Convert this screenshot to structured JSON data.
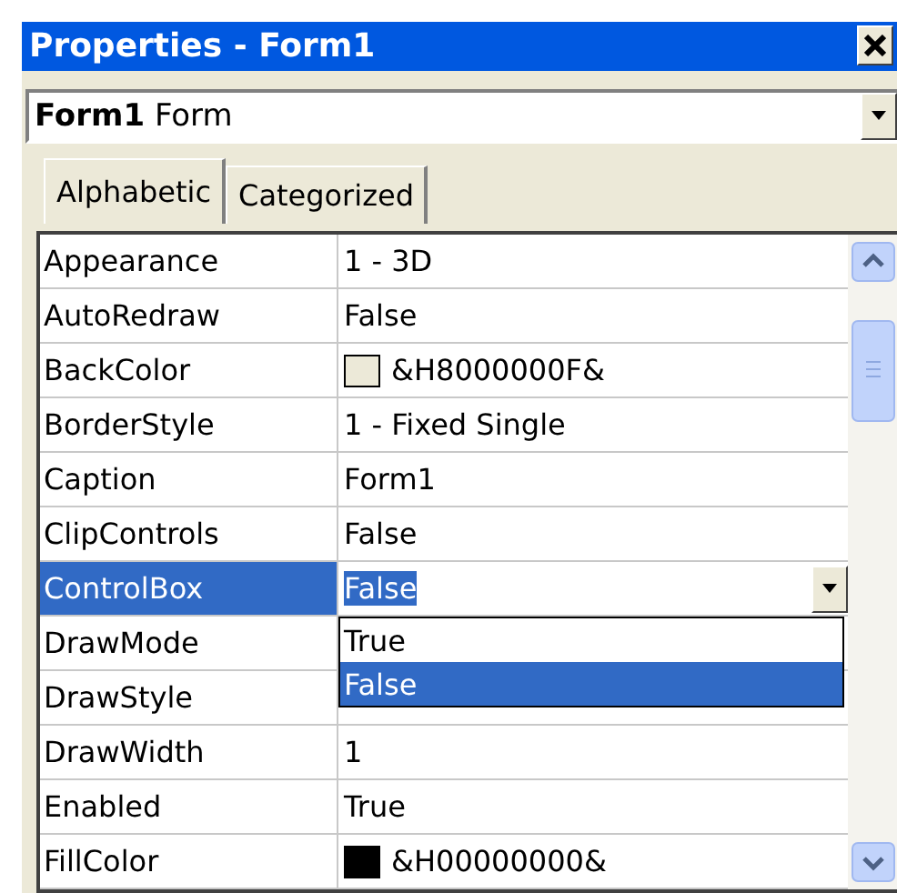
{
  "window": {
    "title": "Properties - Form1"
  },
  "object_selector": {
    "name": "Form1",
    "type": "Form"
  },
  "tabs": [
    {
      "label": "Alphabetic",
      "selected": true
    },
    {
      "label": "Categorized",
      "selected": false
    }
  ],
  "properties": [
    {
      "name": "Appearance",
      "value": "1 - 3D",
      "selected": false
    },
    {
      "name": "AutoRedraw",
      "value": "False",
      "selected": false
    },
    {
      "name": "BackColor",
      "value": "&H8000000F&",
      "color": "#ece9d8",
      "selected": false
    },
    {
      "name": "BorderStyle",
      "value": "1 - Fixed Single",
      "selected": false
    },
    {
      "name": "Caption",
      "value": "Form1",
      "selected": false
    },
    {
      "name": "ClipControls",
      "value": "False",
      "selected": false
    },
    {
      "name": "ControlBox",
      "value": "False",
      "selected": true,
      "dropdown": {
        "options": [
          {
            "label": "True",
            "selected": false
          },
          {
            "label": "False",
            "selected": true
          }
        ]
      }
    },
    {
      "name": "DrawMode",
      "selected": false
    },
    {
      "name": "DrawStyle",
      "selected": false
    },
    {
      "name": "DrawWidth",
      "value": "1",
      "selected": false
    },
    {
      "name": "Enabled",
      "value": "True",
      "selected": false
    },
    {
      "name": "FillColor",
      "value": "&H00000000&",
      "color": "#000000",
      "selected": false
    }
  ]
}
